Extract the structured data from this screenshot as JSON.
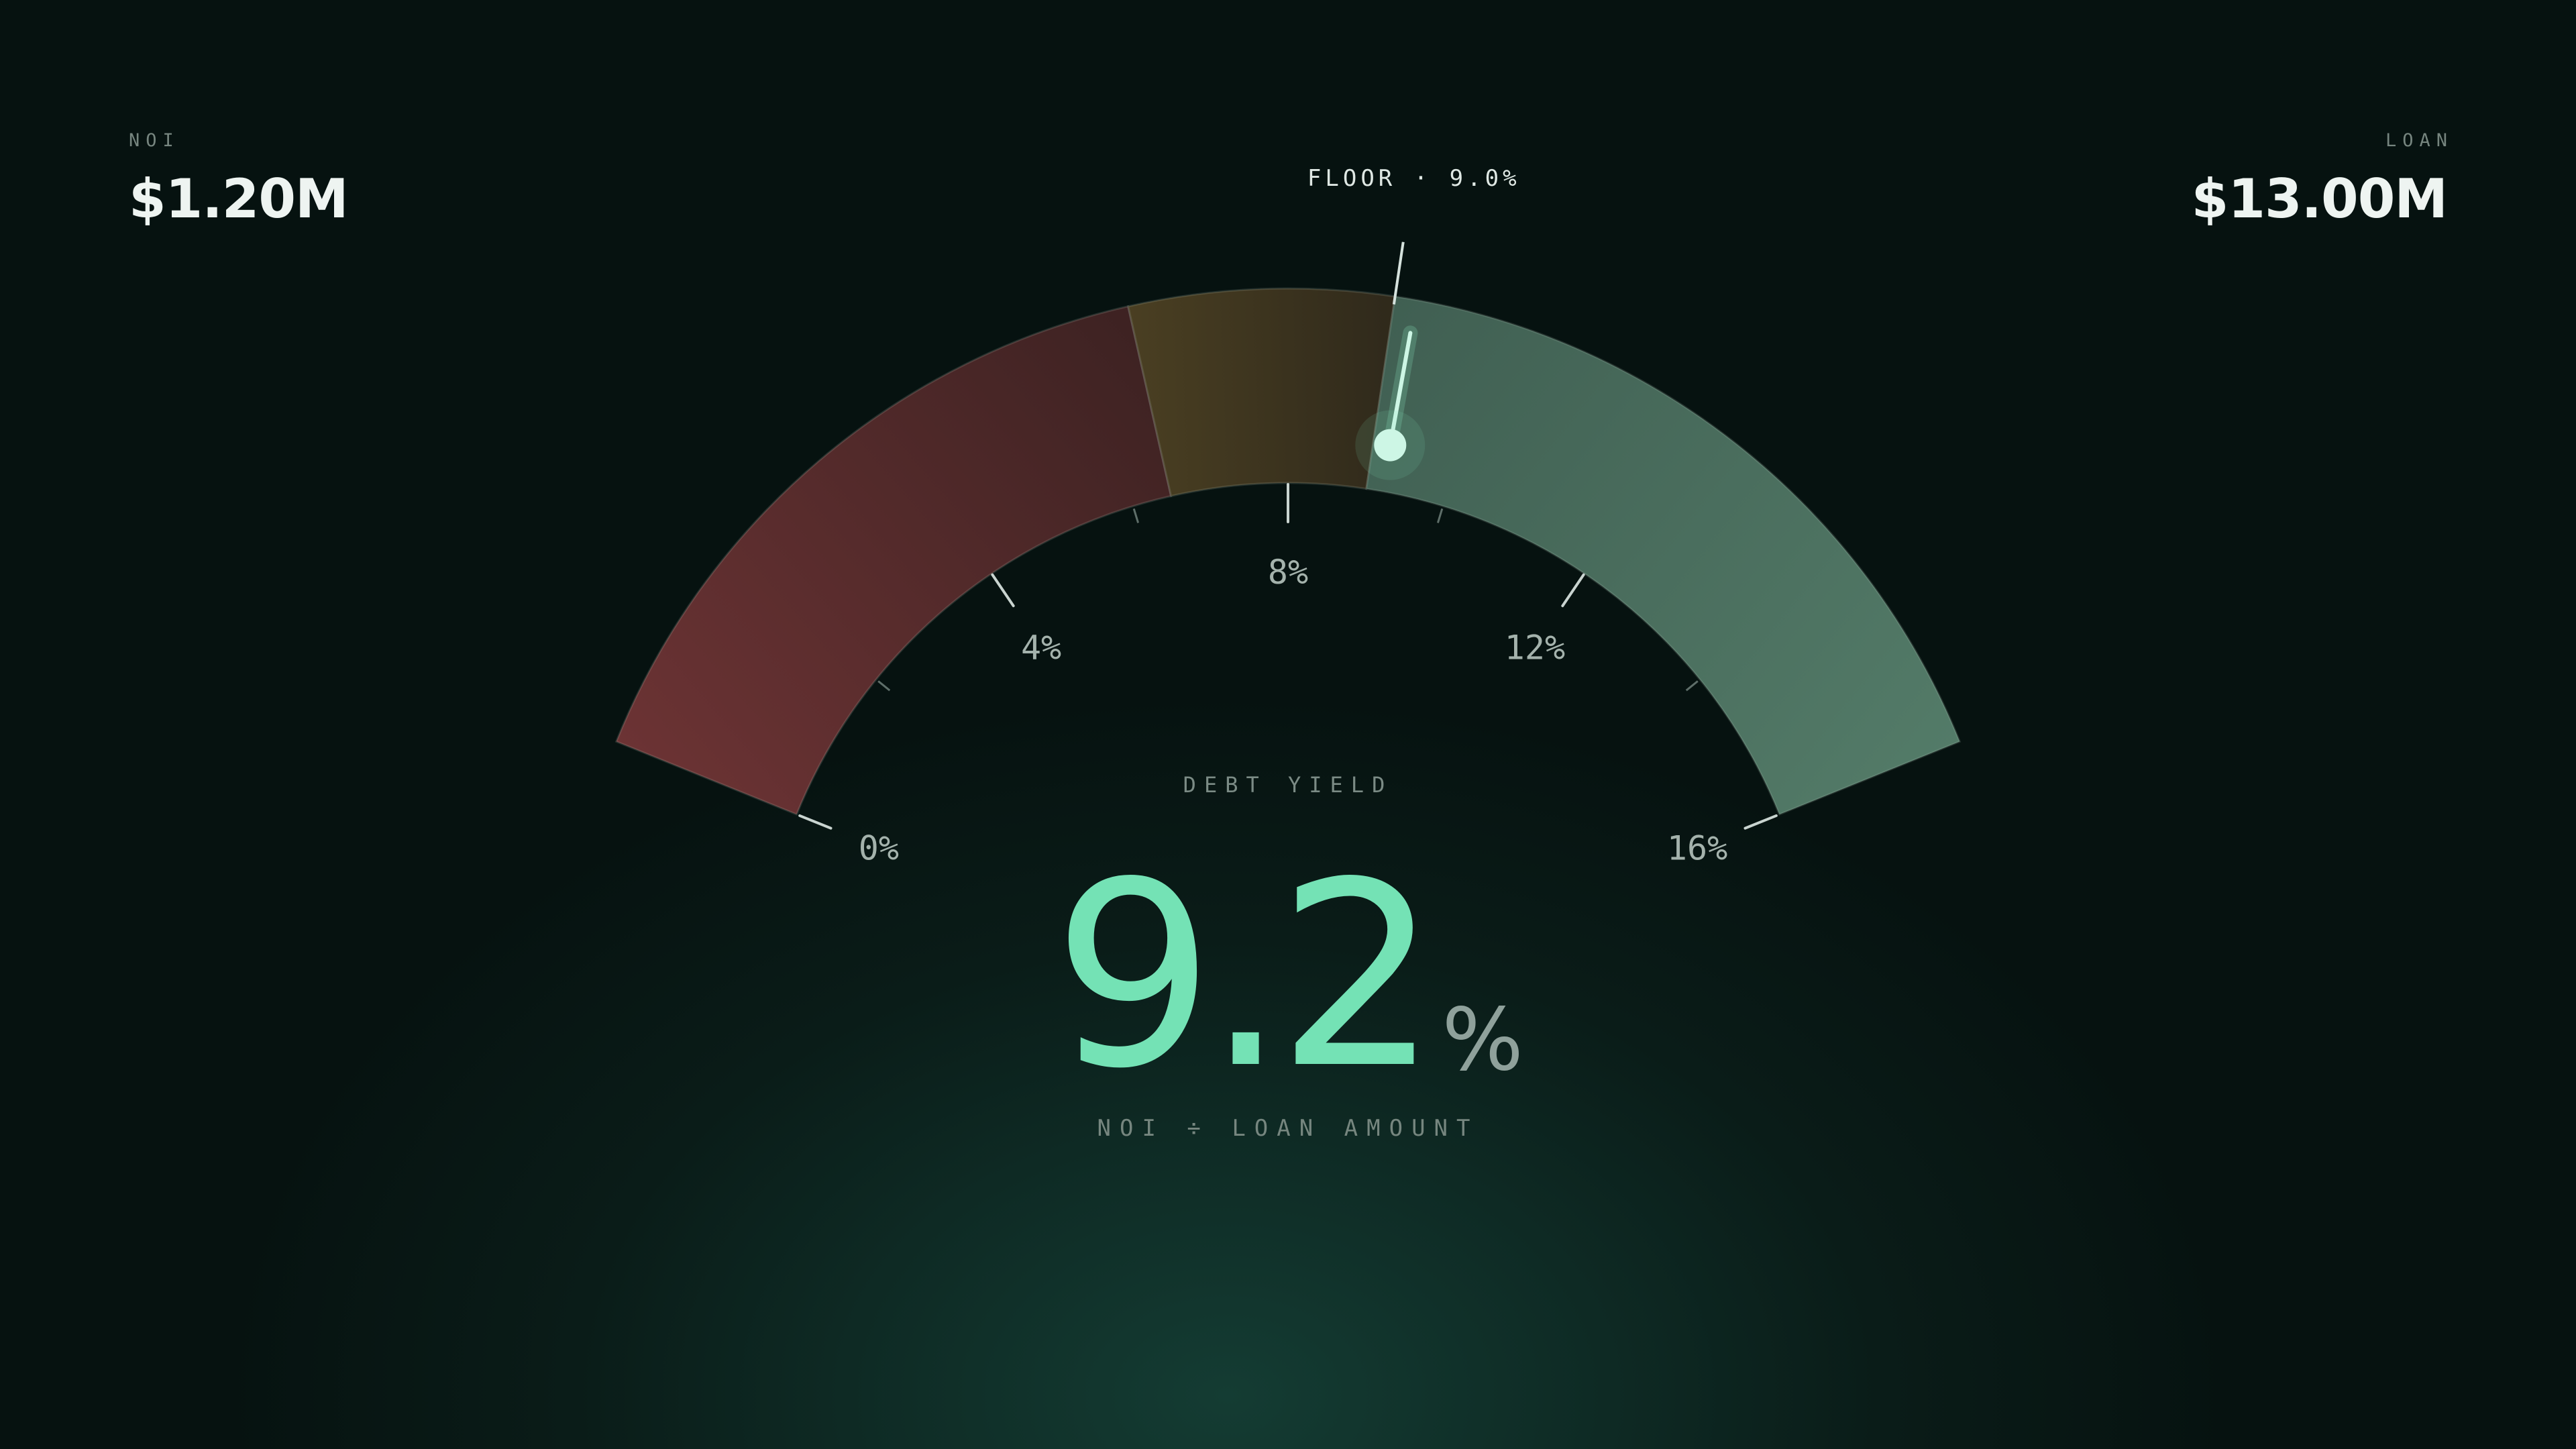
{
  "noi": {
    "label": "NOI",
    "value": "$1.20M"
  },
  "loan": {
    "label": "LOAN",
    "value": "$13.00M"
  },
  "gauge": {
    "min": 0,
    "max": 16,
    "value": 9.2,
    "floor": 9.0,
    "floor_label": "FLOOR · 9.0%",
    "ticks": [
      {
        "value": 0,
        "label": "0%"
      },
      {
        "value": 4,
        "label": "4%"
      },
      {
        "value": 8,
        "label": "8%"
      },
      {
        "value": 12,
        "label": "12%"
      },
      {
        "value": 16,
        "label": "16%"
      }
    ],
    "minor_ticks": [
      2,
      6,
      10,
      14
    ],
    "zones": [
      {
        "name": "below",
        "from": 0,
        "to": 6.5,
        "color_start": "#6c3334",
        "color_end": "#3d2222"
      },
      {
        "name": "near",
        "from": 6.5,
        "to": 9.0,
        "color_start": "#4a3f22",
        "color_end": "#2f291b"
      },
      {
        "name": "above",
        "from": 9.0,
        "to": 16,
        "color_start": "#405f52",
        "color_end": "#537b68"
      }
    ],
    "needle_color": "#cdf6e5"
  },
  "metric": {
    "label": "DEBT YIELD",
    "value": "9.2",
    "unit": "%",
    "formula": "NOI ÷ LOAN AMOUNT"
  }
}
